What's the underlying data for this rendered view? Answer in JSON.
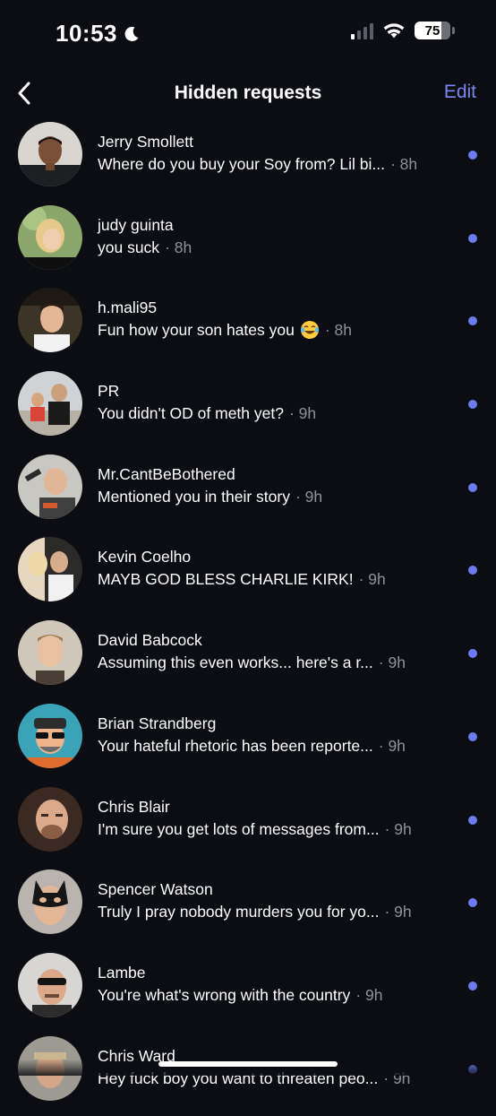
{
  "status_bar": {
    "time": "10:53",
    "battery_percent": "75",
    "signal_bars_on": 1,
    "icons": [
      "moon-icon",
      "signal-icon",
      "wifi-icon",
      "battery-icon"
    ]
  },
  "header": {
    "title": "Hidden requests",
    "edit_label": "Edit",
    "back_icon": "chevron-left-icon"
  },
  "colors": {
    "background": "#0b0d12",
    "accent": "#7b86f2",
    "unread_dot": "#6c7bf0",
    "secondary_text": "#8e929b"
  },
  "requests": [
    {
      "name": "Jerry Smollett",
      "preview": "Where do you buy your Soy from? Lil bi...",
      "time": "· 8h",
      "unread": true
    },
    {
      "name": "judy guinta",
      "preview": "you suck",
      "time": "· 8h",
      "unread": true
    },
    {
      "name": "h.mali95",
      "preview": "Fun how your son hates you",
      "emoji": "laughing-tears-emoji",
      "time": "· 8h",
      "unread": true
    },
    {
      "name": "PR",
      "preview": "You didn't OD of meth yet?",
      "time": "· 9h",
      "unread": true
    },
    {
      "name": "Mr.CantBeBothered",
      "preview": "Mentioned you in their story",
      "time": "· 9h",
      "unread": true
    },
    {
      "name": "Kevin Coelho",
      "preview": "MAYB GOD BLESS CHARLIE KIRK!",
      "time": "· 9h",
      "unread": true
    },
    {
      "name": "David Babcock",
      "preview": "Assuming this even works... here's a r...",
      "time": "· 9h",
      "unread": true
    },
    {
      "name": "Brian Strandberg",
      "preview": "Your hateful rhetoric has been reporte...",
      "time": "· 9h",
      "unread": true
    },
    {
      "name": "Chris Blair",
      "preview": "I'm sure you get lots of messages from...",
      "time": "· 9h",
      "unread": true
    },
    {
      "name": "Spencer Watson",
      "preview": "Truly I pray nobody murders you for yo...",
      "time": "· 9h",
      "unread": true
    },
    {
      "name": "Lambe",
      "preview": "You're what's wrong with the country",
      "time": "· 9h",
      "unread": true
    },
    {
      "name": "Chris Ward",
      "preview": "Hey fuck boy you want to threaten peo...",
      "time": "· 9h",
      "unread": true
    }
  ]
}
